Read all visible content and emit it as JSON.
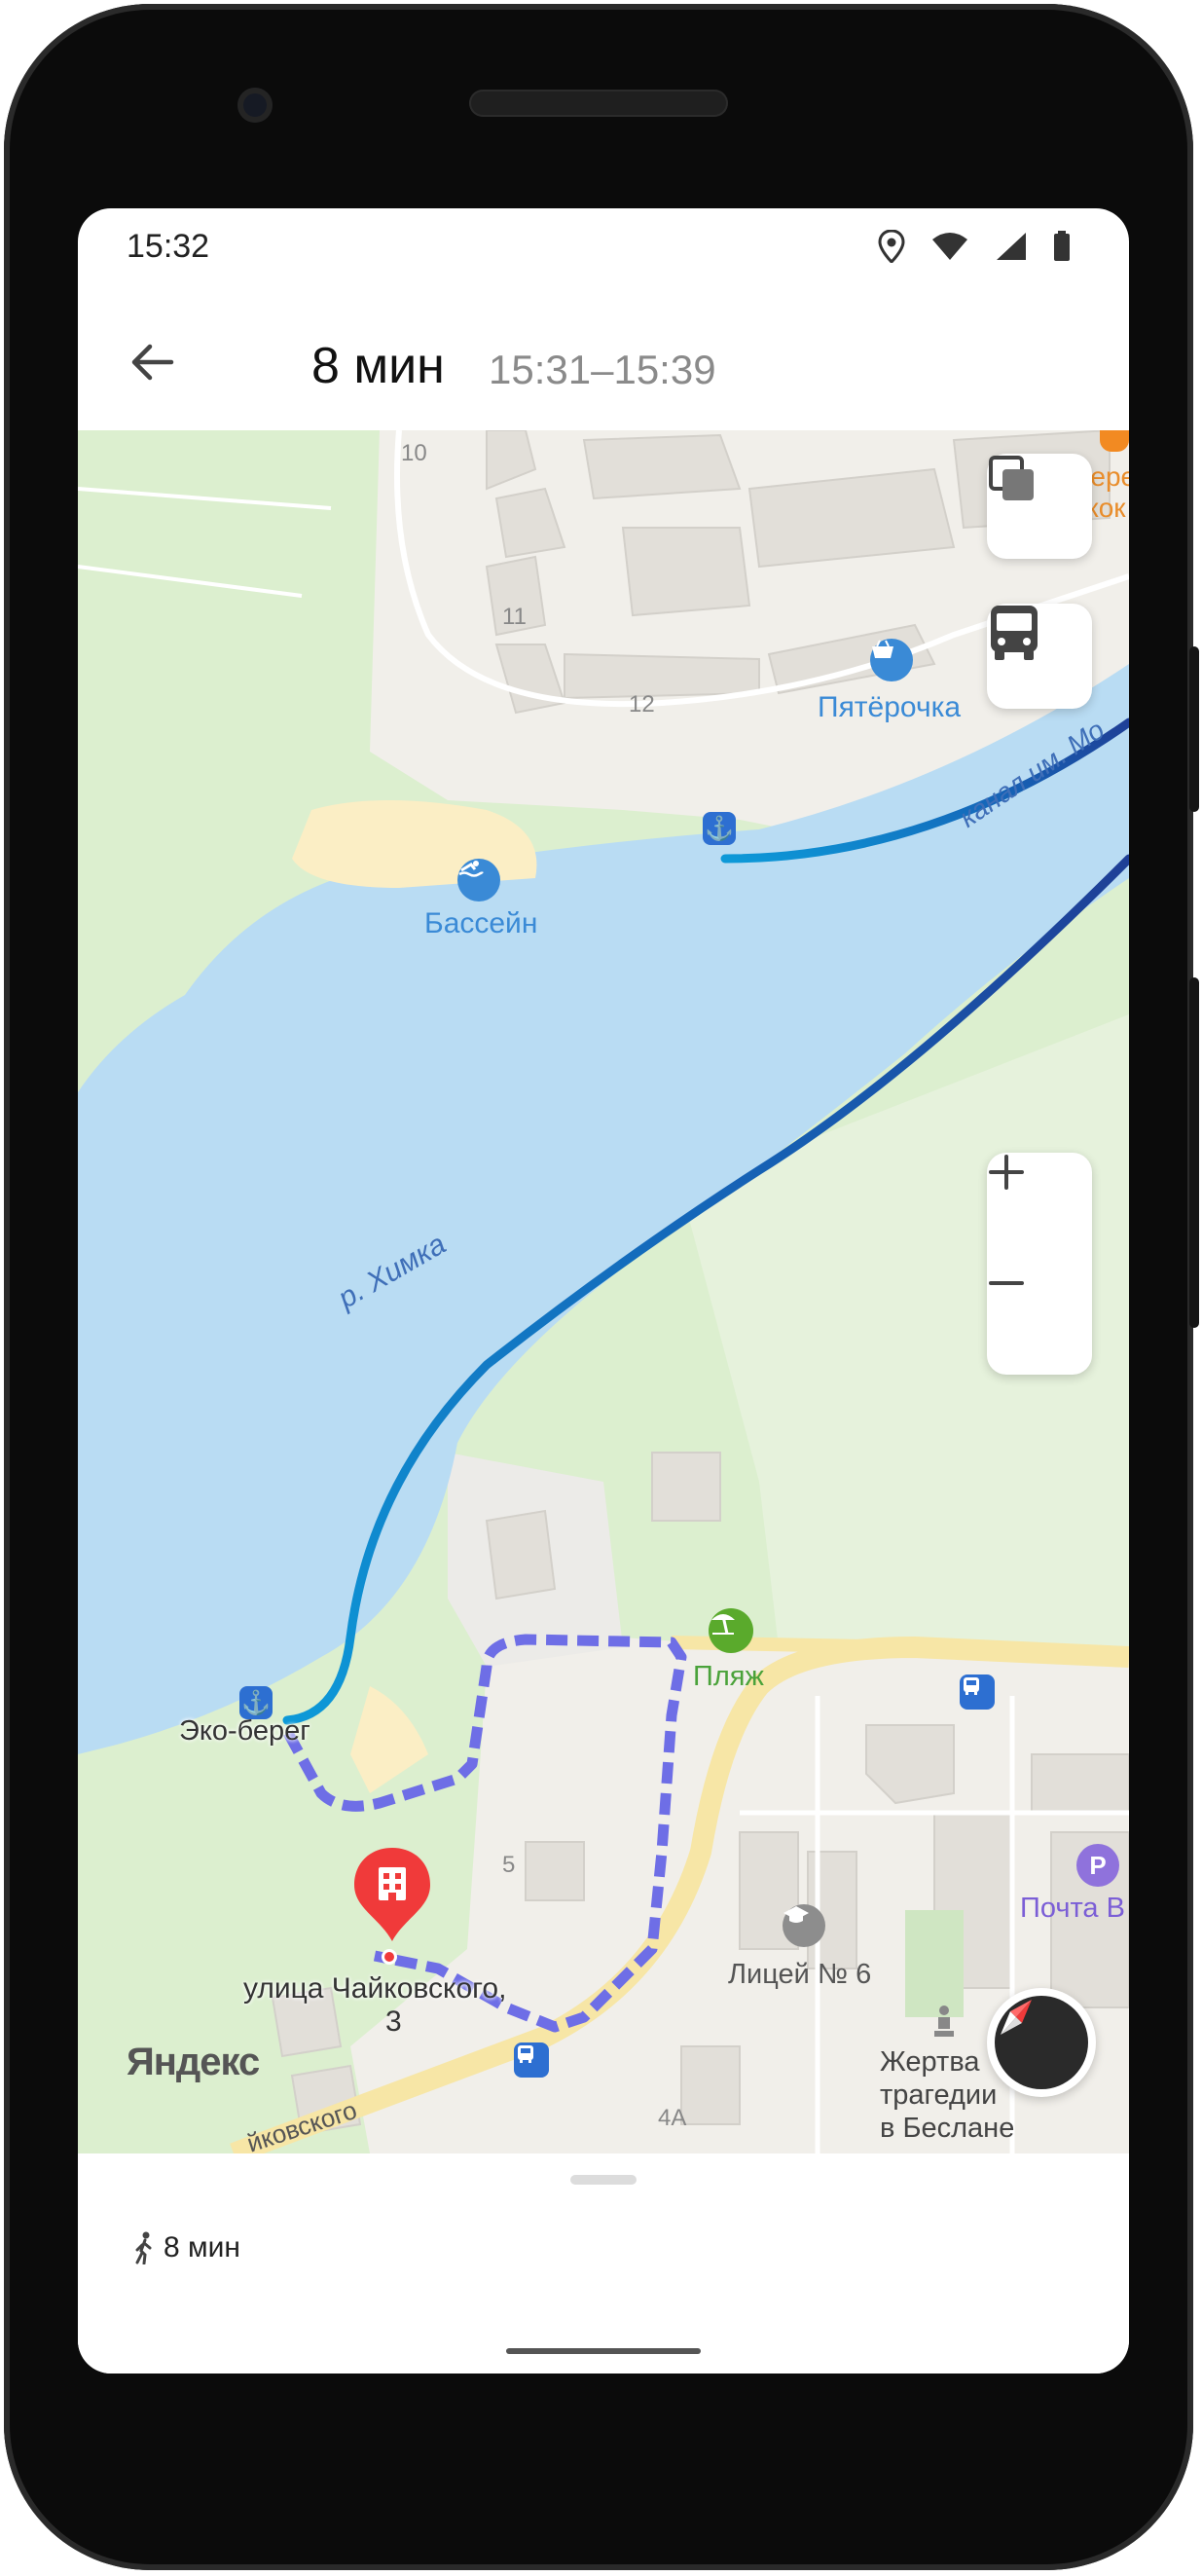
{
  "status_bar": {
    "time": "15:32"
  },
  "header": {
    "duration": "8 мин",
    "time_range": "15:31–15:39"
  },
  "map": {
    "labels": {
      "building_10": "10",
      "building_11": "11",
      "building_12": "12",
      "building_5": "5",
      "building_4a": "4А",
      "berezhok_1": "Бере",
      "berezhok_2": "жок",
      "pyaterochka": "Пятёрочка",
      "pool": "Бассейн",
      "canal": "канал им. Мо",
      "river": "р. Химка",
      "eco_bereg": "Эко-берег",
      "beach": "Пляж",
      "lyceum": "Лицей № 6",
      "post": "Почта В",
      "memorial_1": "Жертва",
      "memorial_2": "трагедии",
      "memorial_3": "в Беслане",
      "street_bottom": "йковского",
      "destination_1": "улица Чайковского,",
      "destination_2": "3",
      "brand": "Яндекс"
    },
    "icons": [
      "layers-icon",
      "bus-icon",
      "plus-icon",
      "minus-icon",
      "compass-icon",
      "anchor-icon",
      "pin-icon",
      "beach-icon",
      "bus-stop-icon"
    ]
  },
  "bottom_sheet": {
    "walk_time": "8 мин"
  },
  "colors": {
    "water": "#b9dcf3",
    "park": "#dcefcf",
    "route_boat_start": "#0d99d8",
    "route_boat_end": "#1f3f96",
    "route_walk": "#6e6ee6",
    "pin": "#f03a3a"
  }
}
